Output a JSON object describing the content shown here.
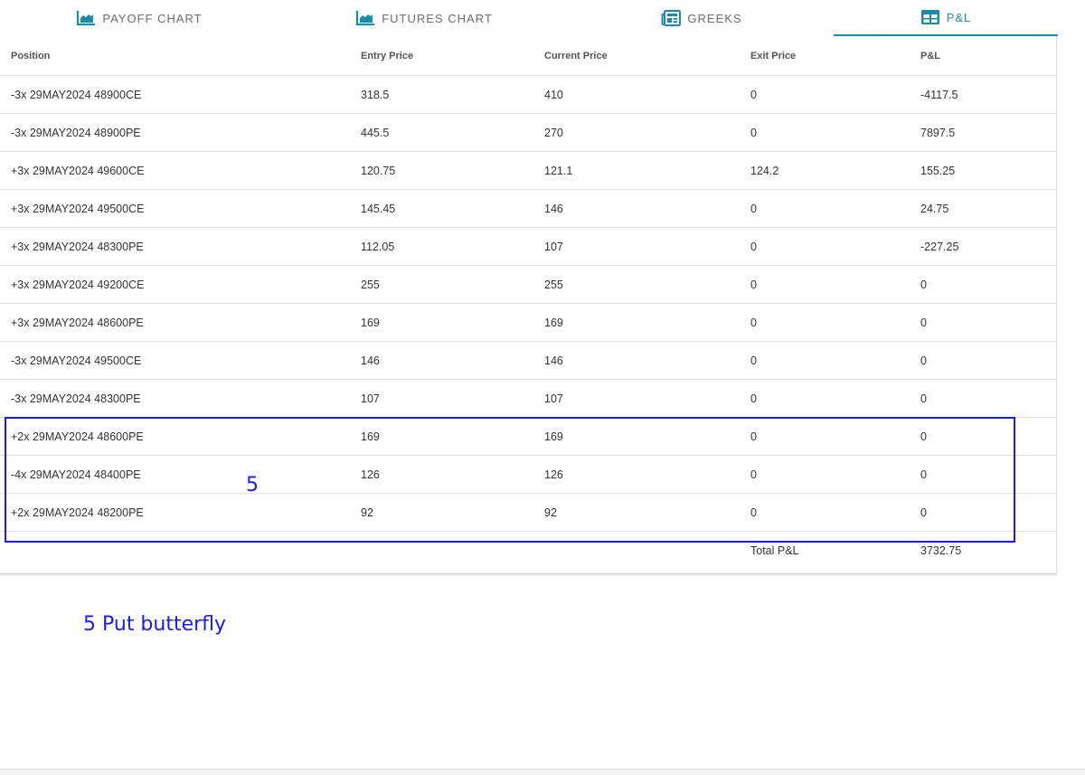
{
  "tabs": [
    {
      "label": "PAYOFF CHART",
      "icon": "area-chart-icon",
      "active": false
    },
    {
      "label": "FUTURES CHART",
      "icon": "area-chart-icon",
      "active": false
    },
    {
      "label": "GREEKS",
      "icon": "newspaper-icon",
      "active": false
    },
    {
      "label": "P&L",
      "icon": "table-icon",
      "active": true
    }
  ],
  "accent_color": "#1a8ca8",
  "annotation_color": "#1a1aff",
  "table": {
    "headers": [
      "Position",
      "Entry Price",
      "Current Price",
      "Exit Price",
      "P&L"
    ],
    "rows": [
      [
        "-3x 29MAY2024 48900CE",
        "318.5",
        "410",
        "0",
        "-4117.5"
      ],
      [
        "-3x 29MAY2024 48900PE",
        "445.5",
        "270",
        "0",
        "7897.5"
      ],
      [
        "+3x 29MAY2024 49600CE",
        "120.75",
        "121.1",
        "124.2",
        "155.25"
      ],
      [
        "+3x 29MAY2024 49500CE",
        "145.45",
        "146",
        "0",
        "24.75"
      ],
      [
        "+3x 29MAY2024 48300PE",
        "112.05",
        "107",
        "0",
        "-227.25"
      ],
      [
        "+3x 29MAY2024 49200CE",
        "255",
        "255",
        "0",
        "0"
      ],
      [
        "+3x 29MAY2024 48600PE",
        "169",
        "169",
        "0",
        "0"
      ],
      [
        "-3x 29MAY2024 49500CE",
        "146",
        "146",
        "0",
        "0"
      ],
      [
        "-3x 29MAY2024 48300PE",
        "107",
        "107",
        "0",
        "0"
      ],
      [
        "+2x 29MAY2024 48600PE",
        "169",
        "169",
        "0",
        "0"
      ],
      [
        "-4x 29MAY2024 48400PE",
        "126",
        "126",
        "0",
        "0"
      ],
      [
        "+2x 29MAY2024 48200PE",
        "92",
        "92",
        "0",
        "0"
      ]
    ],
    "total_label": "Total P&L",
    "total_value": "3732.75"
  },
  "annotations": {
    "box_number": "5",
    "note": "5 Put butterfly"
  }
}
